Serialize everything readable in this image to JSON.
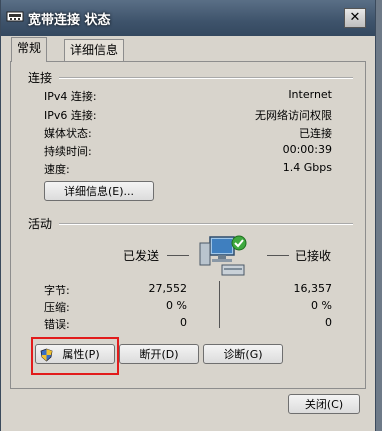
{
  "window": {
    "title": "宽带连接 状态",
    "close_symbol": "✕"
  },
  "tabs": [
    {
      "label": "常规",
      "active": true
    },
    {
      "label": "详细信息",
      "active": false
    }
  ],
  "connection": {
    "heading": "连接",
    "rows": [
      {
        "label": "IPv4 连接:",
        "value": "Internet"
      },
      {
        "label": "IPv6 连接:",
        "value": "无网络访问权限"
      },
      {
        "label": "媒体状态:",
        "value": "已连接"
      },
      {
        "label": "持续时间:",
        "value": "00:00:39"
      },
      {
        "label": "速度:",
        "value": "1.4 Gbps"
      }
    ],
    "details_button": "详细信息(E)..."
  },
  "activity": {
    "heading": "活动",
    "sent_label": "已发送",
    "received_label": "已接收",
    "rows": [
      {
        "label": "字节:",
        "sent": "27,552",
        "received": "16,357"
      },
      {
        "label": "压缩:",
        "sent": "0 %",
        "received": "0 %"
      },
      {
        "label": "错误:",
        "sent": "0",
        "received": "0"
      }
    ]
  },
  "buttons": {
    "properties": "属性(P)",
    "disconnect": "断开(D)",
    "diagnose": "诊断(G)",
    "close": "关闭(C)"
  },
  "colors": {
    "highlight": "#e21b1b",
    "title_bar": "#3e536b"
  }
}
